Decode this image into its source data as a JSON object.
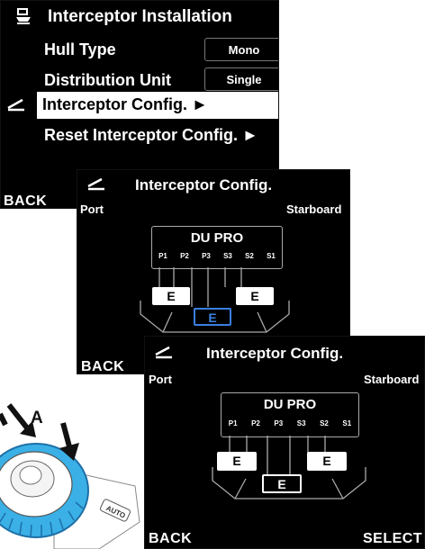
{
  "screen1": {
    "title": "Interceptor Installation",
    "header_icon": "boat-icon",
    "hull_type_label": "Hull Type",
    "hull_type_value": "Mono",
    "distribution_unit_label": "Distribution Unit",
    "distribution_unit_value": "Single",
    "interceptor_config_label": "Interceptor Config. ►",
    "reset_label": "Reset Interceptor Config. ►",
    "back_label": "BACK"
  },
  "screen2": {
    "title": "Interceptor Config.",
    "port_label": "Port",
    "starboard_label": "Starboard",
    "du_label": "DU PRO",
    "ports": [
      "P1",
      "P2",
      "P3",
      "S3",
      "S2",
      "S1"
    ],
    "e_left": "E",
    "e_right": "E",
    "e_center": "E",
    "back_label": "BACK",
    "highlight_color": "#3a7fe0"
  },
  "screen3": {
    "title": "Interceptor Config.",
    "port_label": "Port",
    "starboard_label": "Starboard",
    "du_label": "DU PRO",
    "ports": [
      "P1",
      "P2",
      "P3",
      "S3",
      "S2",
      "S1"
    ],
    "e_left": "E",
    "e_right": "E",
    "e_center": "E",
    "back_label": "BACK",
    "select_label": "SELECT"
  },
  "callout": {
    "label": "A",
    "knob_label": "AUTO"
  }
}
